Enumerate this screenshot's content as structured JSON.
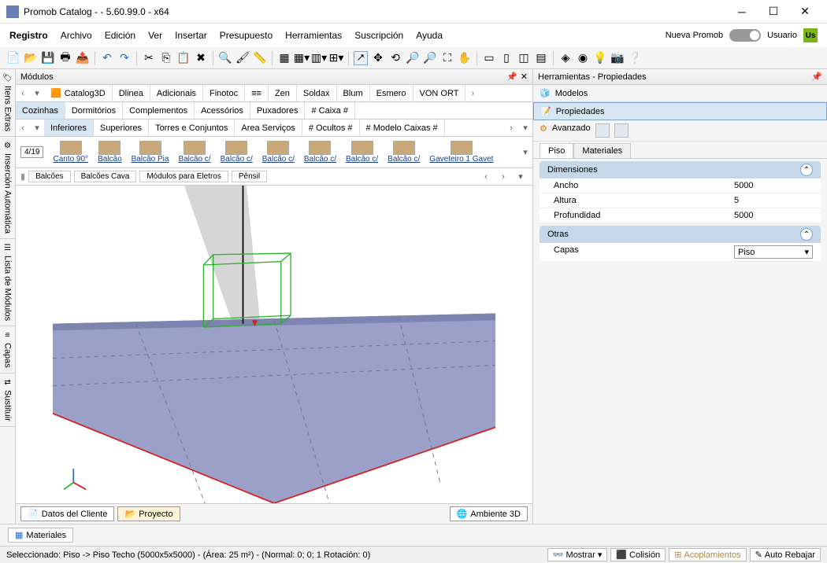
{
  "title": "Promob Catalog -        - 5.60.99.0 - x64",
  "menubar": [
    "Registro",
    "Archivo",
    "Edición",
    "Ver",
    "Insertar",
    "Presupuesto",
    "Herramientas",
    "Suscripción",
    "Ayuda"
  ],
  "nueva_promob": "Nueva Promob",
  "usuario": "Usuario",
  "usuario_badge": "Us",
  "sidebar_tabs": [
    "Itens Extras",
    "Inserción Automática",
    "Lista de Módulos",
    "Capas",
    "Sustituir"
  ],
  "modules_header": "Módulos",
  "herramientas_header": "Herramientas - Propiedades",
  "nav1": [
    "Catalog3D",
    "Dlinea",
    "Adicionais",
    "Finotoc",
    "≡≡",
    "Zen",
    "Soldax",
    "Blum",
    "Esmero",
    "VON ORT"
  ],
  "nav2": [
    "Cozinhas",
    "Dormitórios",
    "Complementos",
    "Acessórios",
    "Puxadores",
    "# Caixa #"
  ],
  "nav3": [
    "Inferiores",
    "Superiores",
    "Torres e Conjuntos",
    "Area Serviços",
    "# Ocultos #",
    "# Modelo Caixas #"
  ],
  "page": "4/19",
  "thumbs": [
    "Canto 90°",
    "Balcão",
    "Balcão Pia",
    "Balcão c/",
    "Balcão c/",
    "Balcão c/",
    "Balcão c/",
    "Balcão c/",
    "Balcão c/",
    "Gaveteiro 1 Gavet"
  ],
  "filters": [
    "Balcões",
    "Balcões Cava",
    "Módulos para Eletros",
    "Pênsil"
  ],
  "bottom_tabs": {
    "datos": "Datos del Cliente",
    "proyecto": "Proyecto",
    "ambiente": "Ambiente 3D"
  },
  "right": {
    "modelos": "Modelos",
    "propiedades": "Propiedades",
    "avanzado": "Avanzado",
    "tabs": [
      "Piso",
      "Materiales"
    ],
    "section1": "Dimensiones",
    "props": [
      {
        "label": "Ancho",
        "value": "5000"
      },
      {
        "label": "Altura",
        "value": "5"
      },
      {
        "label": "Profundidad",
        "value": "5000"
      }
    ],
    "section2": "Otras",
    "capas_label": "Capas",
    "capas_value": "Piso"
  },
  "materials_tab": "Materiales",
  "status_text": "Seleccionado: Piso -> Piso Techo (5000x5x5000) - (Área: 25 m²) - (Normal: 0; 0; 1 Rotación: 0)",
  "status_buttons": {
    "mostrar": "Mostrar",
    "colision": "Colisión",
    "acoplamientos": "Acoplamientos",
    "auto": "Auto Rebajar"
  }
}
